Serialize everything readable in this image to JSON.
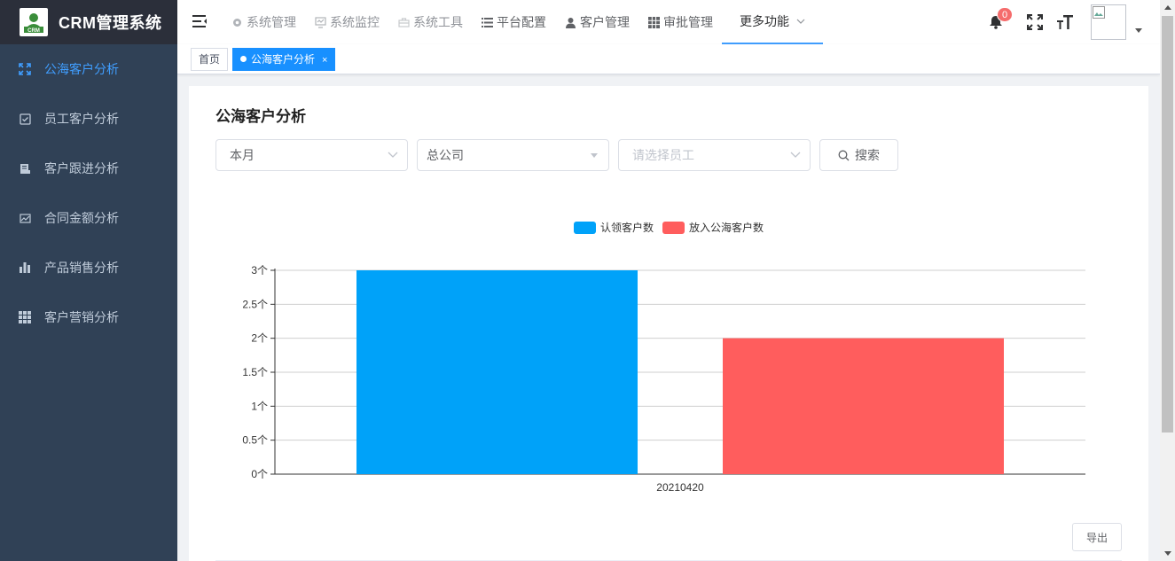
{
  "app": {
    "logo_text": "CRM",
    "title": "CRM管理系统"
  },
  "sidebar": {
    "items": [
      {
        "label": "公海客户分析",
        "icon": "expand-icon",
        "active": true
      },
      {
        "label": "员工客户分析",
        "icon": "checkbox-icon"
      },
      {
        "label": "客户跟进分析",
        "icon": "document-icon"
      },
      {
        "label": "合同金额分析",
        "icon": "image-chart-icon"
      },
      {
        "label": "产品销售分析",
        "icon": "bar-chart-icon"
      },
      {
        "label": "客户营销分析",
        "icon": "grid-icon"
      }
    ]
  },
  "topnav": {
    "items": [
      {
        "label": "系统管理",
        "icon": "gear-icon"
      },
      {
        "label": "系统监控",
        "icon": "monitor-icon"
      },
      {
        "label": "系统工具",
        "icon": "toolbox-icon"
      },
      {
        "label": "平台配置",
        "icon": "list-icon"
      },
      {
        "label": "客户管理",
        "icon": "user-icon"
      },
      {
        "label": "审批管理",
        "icon": "table-icon"
      }
    ],
    "more_label": "更多功能",
    "notification_count": "0"
  },
  "tags": {
    "home": "首页",
    "current": "公海客户分析",
    "close": "×"
  },
  "page": {
    "title": "公海客户分析",
    "filters": {
      "period": "本月",
      "company": "总公司",
      "employee_placeholder": "请选择员工"
    },
    "search_label": "搜索",
    "export_label": "导出"
  },
  "chart_data": {
    "type": "bar",
    "categories": [
      "20210420"
    ],
    "series": [
      {
        "name": "认领客户数",
        "values": [
          3
        ],
        "color": "#00a2f9"
      },
      {
        "name": "放入公海客户数",
        "values": [
          2
        ],
        "color": "#ff5d5d"
      }
    ],
    "yunit": "个",
    "ylim": [
      0,
      3
    ],
    "yticks": [
      "0个",
      "0.5个",
      "1个",
      "1.5个",
      "2个",
      "2.5个",
      "3个"
    ],
    "ytick_values": [
      0,
      0.5,
      1,
      1.5,
      2,
      2.5,
      3
    ],
    "grid": true,
    "legend": "top-center"
  }
}
